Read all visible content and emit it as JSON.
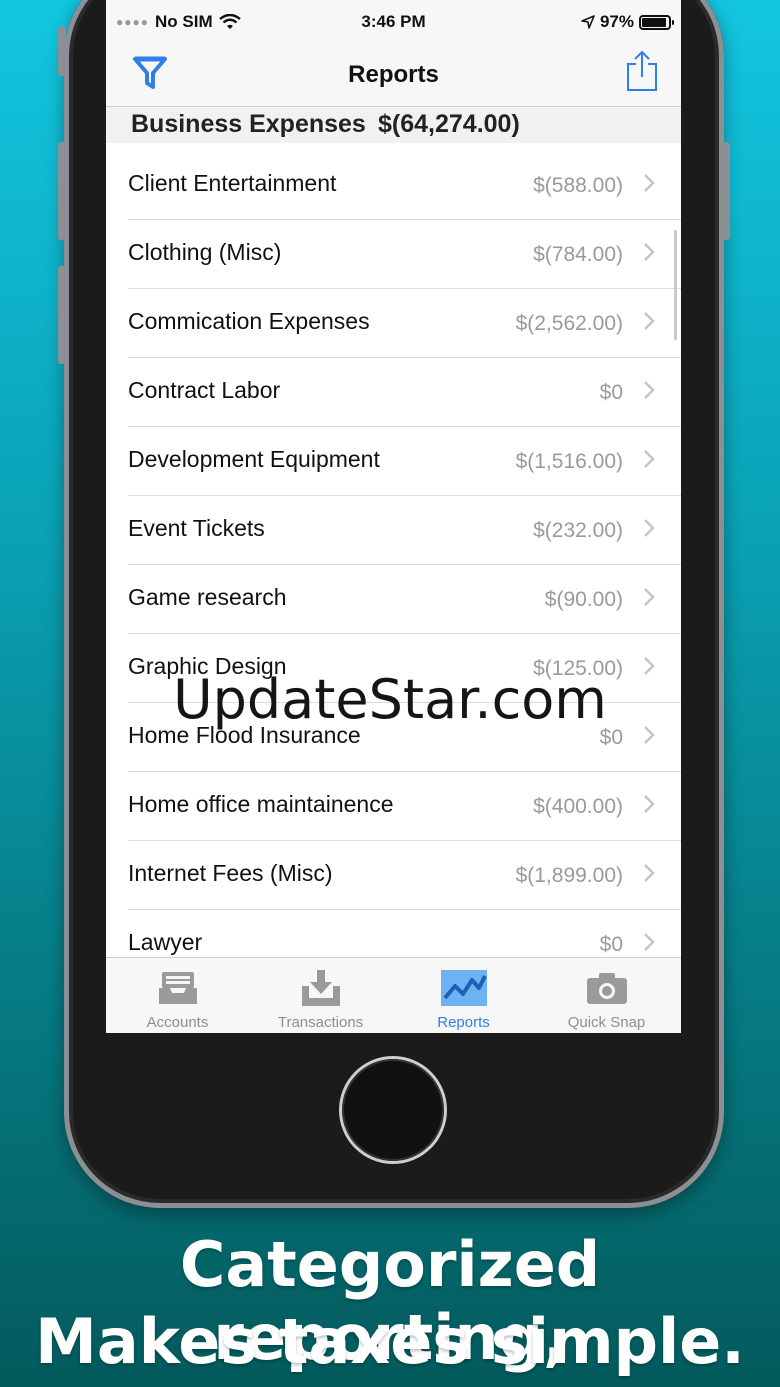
{
  "status": {
    "carrier": "No SIM",
    "time": "3:46 PM",
    "battery": "97%"
  },
  "navbar": {
    "title": "Reports"
  },
  "section": {
    "name": "Business Expenses",
    "total": "$(64,274.00)"
  },
  "rows": [
    {
      "label": "Client Entertainment",
      "value": "$(588.00)"
    },
    {
      "label": "Clothing (Misc)",
      "value": "$(784.00)"
    },
    {
      "label": "Commication Expenses",
      "value": "$(2,562.00)"
    },
    {
      "label": "Contract Labor",
      "value": "$0"
    },
    {
      "label": "Development Equipment",
      "value": "$(1,516.00)"
    },
    {
      "label": "Event Tickets",
      "value": "$(232.00)"
    },
    {
      "label": "Game research",
      "value": "$(90.00)"
    },
    {
      "label": "Graphic Design",
      "value": "$(125.00)"
    },
    {
      "label": "Home Flood Insurance",
      "value": "$0"
    },
    {
      "label": "Home office maintainence",
      "value": "$(400.00)"
    },
    {
      "label": "Internet Fees (Misc)",
      "value": "$(1,899.00)"
    },
    {
      "label": "Lawyer",
      "value": "$0"
    }
  ],
  "tabs": [
    {
      "label": "Accounts",
      "icon": "tray-icon"
    },
    {
      "label": "Transactions",
      "icon": "download-tray-icon"
    },
    {
      "label": "Reports",
      "icon": "chart-line-icon",
      "active": true
    },
    {
      "label": "Quick Snap",
      "icon": "camera-icon"
    }
  ],
  "watermark": "UpdateStar.com",
  "caption": {
    "line1": "Categorized reporting,",
    "line2": "Makes taxes simple."
  },
  "colors": {
    "accent": "#2f7fe8",
    "background_top": "#12c6e0",
    "background_bottom": "#035a5c"
  }
}
